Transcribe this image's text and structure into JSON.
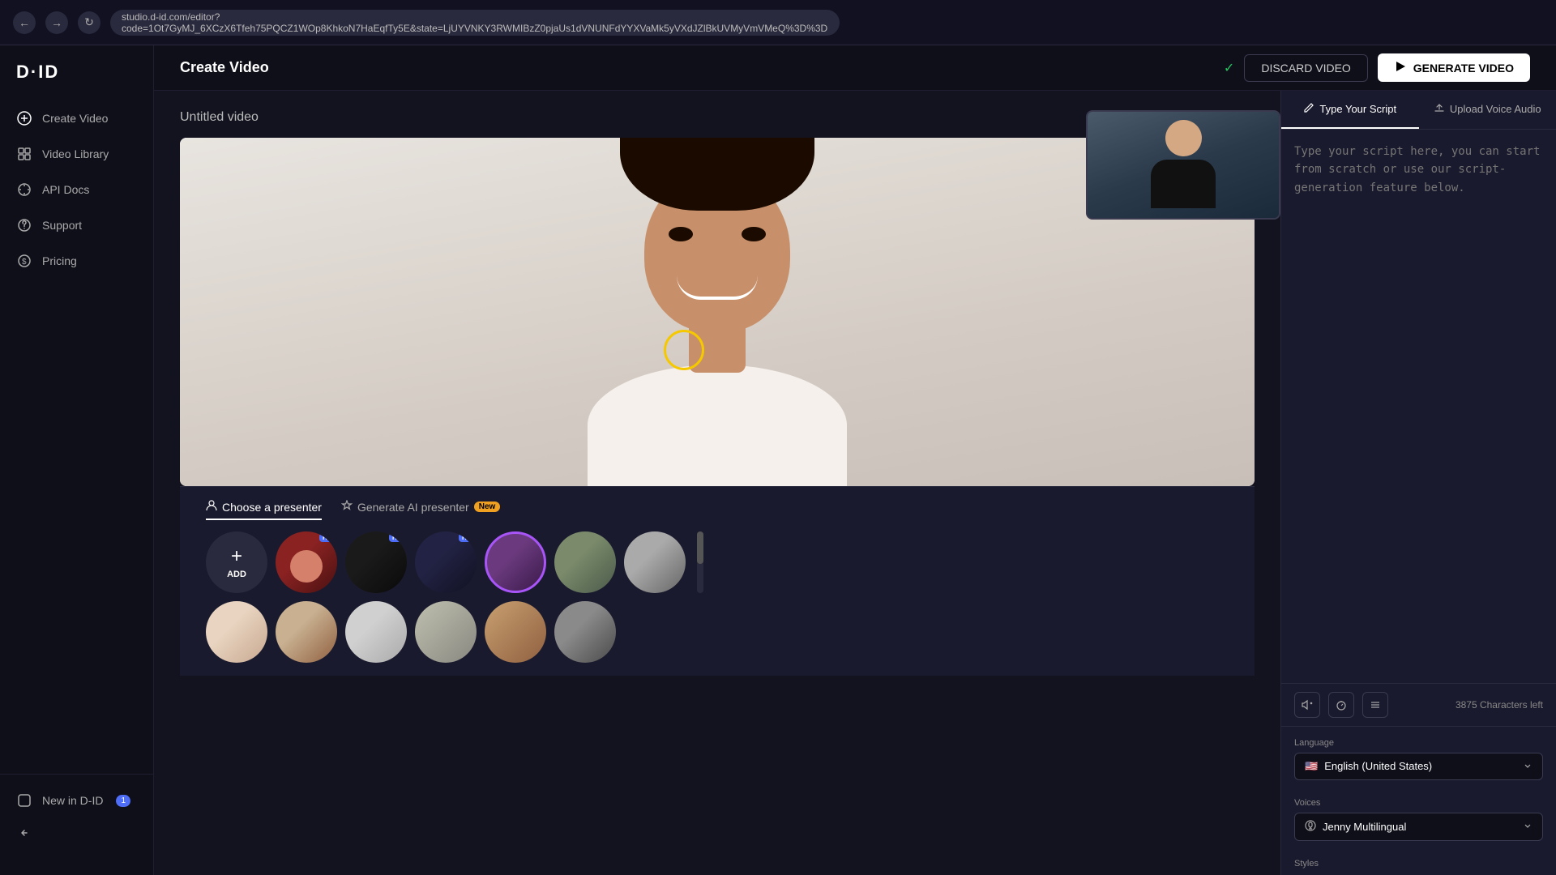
{
  "browser": {
    "url": "studio.d-id.com/editor?code=1Ot7GyMJ_6XCzX6Tfeh75PQCZ1WOp8KhkoN7HaEqfTy5E&state=LjUYVNKY3RWMIBzZ0pjaUs1dVNUNFdYYXVaMk5yVXdJZlBkUVMyVmVMeQ%3D%3D"
  },
  "header": {
    "title": "Create Video",
    "discard_label": "DISCARD VIDEO",
    "generate_label": "GENERATE VIDEO"
  },
  "sidebar": {
    "logo": "D·ID",
    "items": [
      {
        "label": "Create Video",
        "icon": "+"
      },
      {
        "label": "Video Library",
        "icon": "⊞"
      },
      {
        "label": "API Docs",
        "icon": "✕"
      },
      {
        "label": "Support",
        "icon": "✕"
      },
      {
        "label": "Pricing",
        "icon": "$"
      }
    ],
    "bottom_items": [
      {
        "label": "New in D-ID",
        "badge": "1"
      }
    ]
  },
  "video_editor": {
    "video_title": "Untitled video",
    "characters_left": "3875 Characters left",
    "script_placeholder": "Type your script here, you can start from scratch or use our script-generation feature below."
  },
  "script_panel": {
    "tab_script": "Type Your Script",
    "tab_voice": "Upload Voice Audio"
  },
  "presenter_picker": {
    "tab_choose": "Choose a presenter",
    "tab_generate": "Generate AI presenter",
    "new_label": "New",
    "add_label": "ADD"
  },
  "language": {
    "label": "Language",
    "value": "English (United States)",
    "flag": "🇺🇸"
  },
  "voices": {
    "label": "Voices",
    "value": "Jenny Multilingual",
    "icon": "♪"
  },
  "styles": {
    "label": "Styles"
  }
}
